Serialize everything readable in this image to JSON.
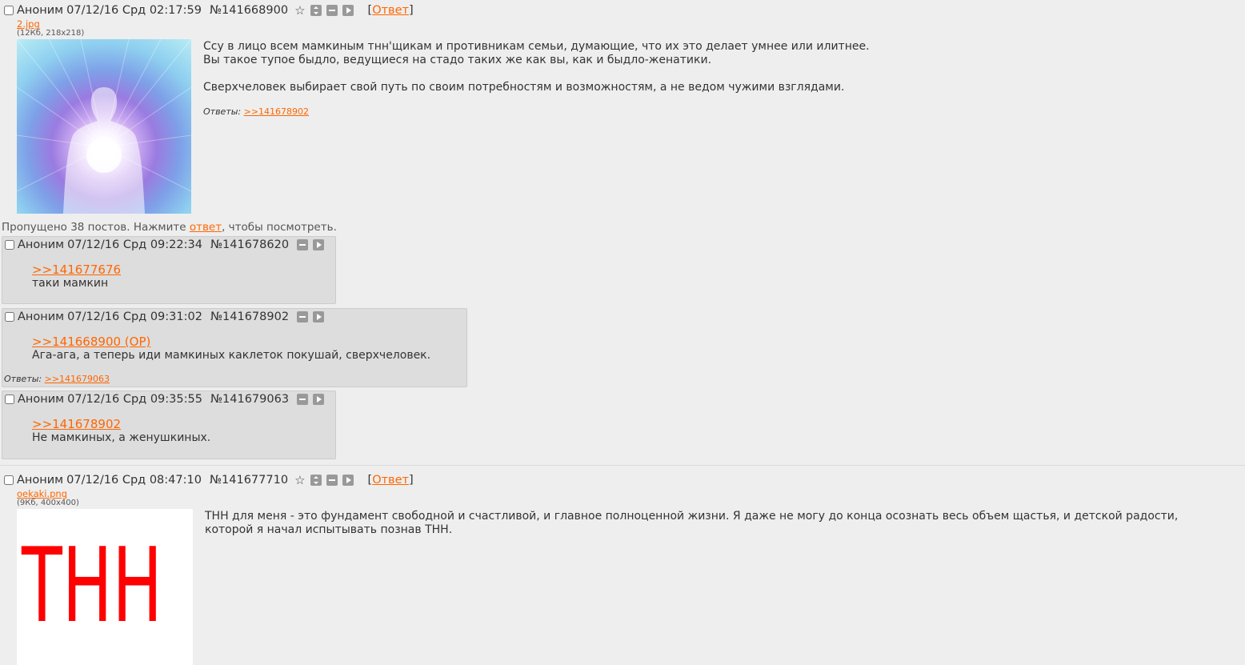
{
  "op1": {
    "name": "Аноним",
    "date": "07/12/16 Срд 02:17:59",
    "number": "№141668900",
    "reply_open": "[",
    "reply_label": "Ответ",
    "reply_close": "]",
    "file_name": "2.jpg",
    "file_meta": "(12Кб, 218x218)",
    "message": [
      "Ссу в лицо всем мамкиным тнн'щикам и противникам семьи, думающие, что их это делает умнее или илитнее.",
      "Вы такое тупое быдло, ведущиеся на стадо таких же как вы, как и быдло-женатики.",
      "Сверхчеловек выбирает свой путь по своим потребностям и возможностям, а не ведом чужими взглядами."
    ],
    "replies_label": "Ответы:",
    "replies_link": ">>141678902"
  },
  "omitted": {
    "before": "Пропущено 38 постов. Нажмите ",
    "link": "ответ",
    "after": ", чтобы посмотреть."
  },
  "post2": {
    "name": "Аноним",
    "date": "07/12/16 Срд 09:22:34",
    "number": "№141678620",
    "quote": ">>141677676",
    "text": "таки мамкин"
  },
  "post3": {
    "name": "Аноним",
    "date": "07/12/16 Срд 09:31:02",
    "number": "№141678902",
    "quote": ">>141668900 (OP)",
    "text": "Ага-ага, а теперь иди мамкиных каклеток покушай, сверхчеловек.",
    "replies_label": "Ответы:",
    "replies_link": ">>141679063"
  },
  "post4": {
    "name": "Аноним",
    "date": "07/12/16 Срд 09:35:55",
    "number": "№141679063",
    "quote": ">>141678902",
    "text": "Не мамкиных, а женушкиных."
  },
  "op2": {
    "name": "Аноним",
    "date": "07/12/16 Срд 08:47:10",
    "number": "№141677710",
    "reply_open": "[",
    "reply_label": "Ответ",
    "reply_close": "]",
    "file_name": "oekaki.png",
    "file_meta": "(9Кб, 400x400)",
    "image_text": "ТНН",
    "message": [
      "ТНН для меня - это фундамент свободной и счастливой, и главное полноценной жизни. Я даже не могу до конца осознать весь объем щастья, и детской радости, которой я начал испытывать познав ТНН."
    ]
  },
  "colors": {
    "link": "#ff6600",
    "reply_bg": "#dddddd",
    "page_bg": "#eeeeee",
    "oekaki_red": "#ff0000"
  },
  "icons": [
    "star-icon",
    "expand-icon",
    "hide-icon",
    "play-icon"
  ]
}
